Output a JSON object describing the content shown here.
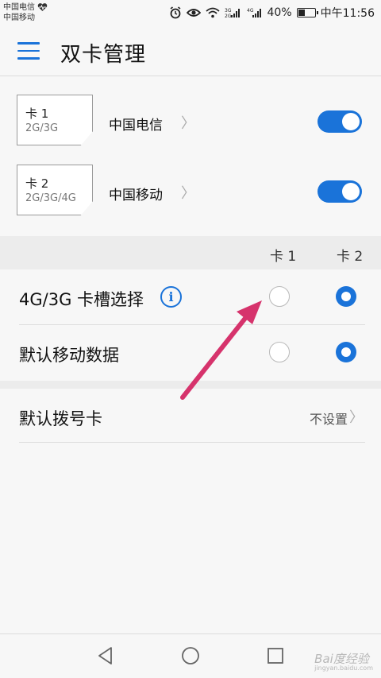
{
  "status_bar": {
    "carrier1": "中国电信",
    "carrier2": "中国移动",
    "network": "4G",
    "battery": "40%",
    "battery_level": 0.4,
    "time": "中午11:56"
  },
  "app_bar": {
    "title": "双卡管理"
  },
  "sims": [
    {
      "slot": "卡 1",
      "type": "2G/3G",
      "carrier": "中国电信",
      "enabled": true
    },
    {
      "slot": "卡 2",
      "type": "2G/3G/4G",
      "carrier": "中国移动",
      "enabled": true
    }
  ],
  "columns": {
    "card1": "卡 1",
    "card2": "卡 2"
  },
  "rows": {
    "slot_select": {
      "label": "4G/3G 卡槽选择",
      "selected": "card2"
    },
    "default_data": {
      "label": "默认移动数据",
      "selected": "card2"
    }
  },
  "dial": {
    "label": "默认拨号卡",
    "value": "不设置"
  },
  "watermark": {
    "text": "Bai度经验",
    "sub": "jingyan.baidu.com"
  },
  "colors": {
    "accent": "#1a73d9",
    "arrow": "#d6336c"
  }
}
